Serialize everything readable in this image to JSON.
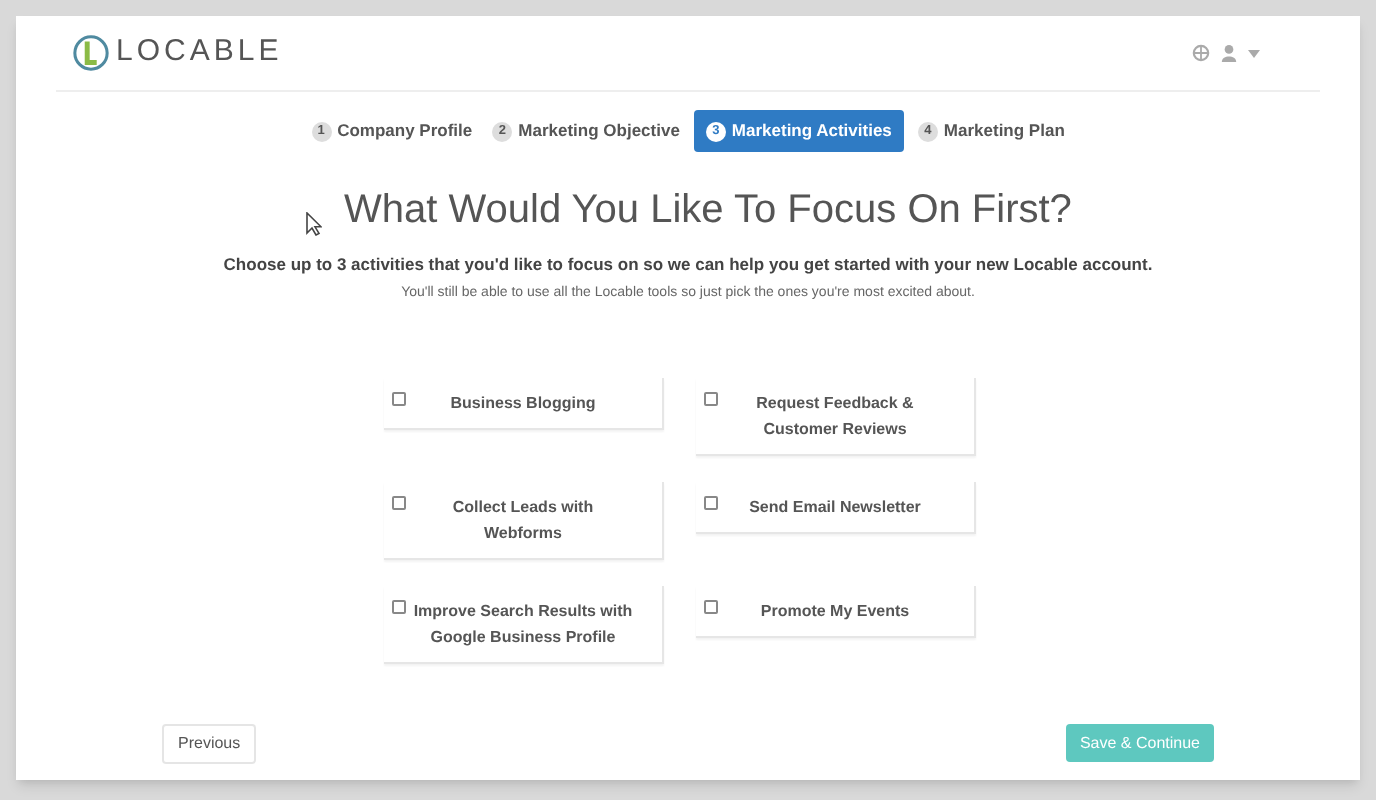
{
  "header": {
    "logo_text": "LOCABLE"
  },
  "steps": [
    {
      "number": "1",
      "label": "Company Profile",
      "selected": false
    },
    {
      "number": "2",
      "label": "Marketing Objective",
      "selected": false
    },
    {
      "number": "3",
      "label": "Marketing Activities",
      "selected": true
    },
    {
      "number": "4",
      "label": "Marketing Plan",
      "selected": false
    }
  ],
  "heading": "What Would You Like To Focus On First?",
  "subheading": "Choose up to 3 activities that you'd like to focus on so we can help you get started with your new Locable account.",
  "note": "You'll still be able to use all the Locable tools so just pick the ones you're most excited about.",
  "activities": [
    {
      "label": "Business Blogging",
      "checked": false
    },
    {
      "label": "Request Feedback & Customer Reviews",
      "checked": false
    },
    {
      "label": "Collect Leads with Webforms",
      "checked": false
    },
    {
      "label": "Send Email Newsletter",
      "checked": false
    },
    {
      "label": "Improve Search Results with Google Business Profile",
      "checked": false
    },
    {
      "label": "Promote My Events",
      "checked": false
    }
  ],
  "buttons": {
    "previous": "Previous",
    "next": "Save & Continue"
  }
}
